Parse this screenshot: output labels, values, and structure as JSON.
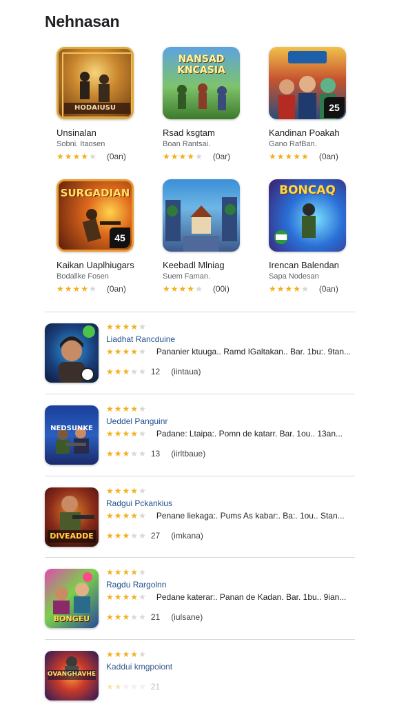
{
  "page": {
    "title": "Nehnasan"
  },
  "grid": [
    {
      "name": "Unsinalan",
      "developer": "Sobni. Itaosen",
      "rating": 3.5,
      "count": "(0an)",
      "art_text": "HODAIUSU",
      "badge_text": ""
    },
    {
      "name": "Rsad ksgtam",
      "developer": "Boan Rantsai.",
      "rating": 3.5,
      "count": "(0ar)",
      "art_text": "NANSAD KNCASIA",
      "badge_text": ""
    },
    {
      "name": "Kandinan Poakah",
      "developer": "Gano RafBan.",
      "rating": 4.5,
      "count": "(0an)",
      "art_text": "",
      "badge_text": "25"
    },
    {
      "name": "Kaikan Uaplhiugars",
      "developer": "Bodallke Fosen",
      "rating": 3.5,
      "count": "(0an)",
      "art_text": "SURGADIAN",
      "badge_text": "45"
    },
    {
      "name": "Keebadl Mlniag",
      "developer": "Suem Faman.",
      "rating": 3.5,
      "count": "(00i)",
      "art_text": "",
      "badge_text": ""
    },
    {
      "name": "Irencan Balendan",
      "developer": "Sapa Nodesan",
      "rating": 3.5,
      "count": "(0an)",
      "art_text": "BONCAQ",
      "badge_text": ""
    }
  ],
  "list": [
    {
      "title": "Liadhat Rancduine",
      "desc": "Pananier ktuuga.. Ramd IGaltakan.. Bar. 1bu:. 9tan...",
      "rating_num": "12",
      "rating_label": "(iintaua)",
      "top_rating": 3.5,
      "mid_rating": 4,
      "low_rating": 2.5,
      "art_text": ""
    },
    {
      "title": "Ueddel Panguinr",
      "desc": "Padane: Ltaipa:. Pomn de katarr. Bar. 1ou.. 13an...",
      "rating_num": "13",
      "rating_label": "(iirltbaue)",
      "top_rating": 3.5,
      "mid_rating": 4,
      "low_rating": 2.5,
      "art_text": "NEDSUNKE NIOD RUSRON"
    },
    {
      "title": "Radgui Pckankius",
      "desc": "Penane liekaga:. Pums As kabar:. Ba:. 1ou.. Stan...",
      "rating_num": "27",
      "rating_label": "(imkana)",
      "top_rating": 3.5,
      "mid_rating": 4,
      "low_rating": 2.5,
      "art_text": "DIVEADDE"
    },
    {
      "title": "Ragdu Rargolnn",
      "desc": "Pedane katerar:. Panan de Kadan. Bar. 1bu.. 9ian...",
      "rating_num": "21",
      "rating_label": "(iulsane)",
      "top_rating": 3.5,
      "mid_rating": 4,
      "low_rating": 2.5,
      "art_text": "BONGEU"
    },
    {
      "title": "Kaddui kmgpoiont",
      "desc": "",
      "rating_num": "21",
      "rating_label": "",
      "top_rating": 3.5,
      "mid_rating": 0,
      "low_rating": 1.5,
      "art_text": "OVANGHAVHE"
    }
  ],
  "colors": {
    "star": "#f2b01e",
    "star_off": "#d7d7d7",
    "title_link": "#1f4e8c"
  }
}
